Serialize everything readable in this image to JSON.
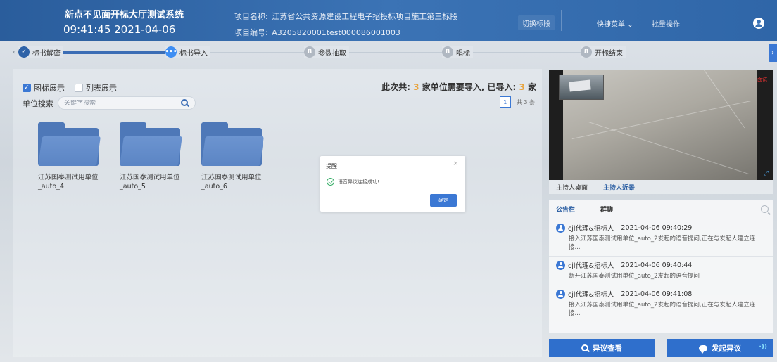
{
  "header": {
    "system_title": "新点不见面开标大厅测试系统",
    "clock": "09:41:45 2021-04-06",
    "project_name_label": "项目名称:",
    "project_name": "江苏省公共资源建设工程电子招投标项目施工第三标段",
    "project_code_label": "项目编号:",
    "project_code": "A3205820001test000086001003",
    "switch_section": "切换标段",
    "quick_menu": "快捷菜单",
    "batch_ops": "批量操作"
  },
  "steps": [
    {
      "label": "标书解密",
      "state": "done"
    },
    {
      "label": "标书导入",
      "state": "active"
    },
    {
      "label": "参数抽取",
      "state": "todo"
    },
    {
      "label": "唱标",
      "state": "todo"
    },
    {
      "label": "开标结束",
      "state": "todo"
    }
  ],
  "main": {
    "view_icon": "图标展示",
    "view_list": "列表展示",
    "search_label": "单位搜索",
    "search_placeholder": "关键字搜索",
    "stat_prefix": "此次共:",
    "stat_total": "3",
    "stat_mid": "家单位需要导入, 已导入:",
    "stat_done": "3",
    "stat_suffix": "家",
    "page": "1",
    "page_total": "共 3 条",
    "folders": [
      {
        "name": "江苏国泰测试用单位_auto_4"
      },
      {
        "name": "江苏国泰测试用单位_auto_5"
      },
      {
        "name": "江苏国泰测试用单位_auto_6"
      }
    ]
  },
  "dialog": {
    "title": "提醒",
    "close": "×",
    "message": "语音异议连接成功!",
    "ok": "确定"
  },
  "video": {
    "live_label": "面试",
    "tab_desktop": "主持人桌面",
    "tab_closeup": "主持人近景"
  },
  "notice": {
    "tab_board": "公告栏",
    "tab_chat": "群聊",
    "messages": [
      {
        "sender": "cjl代理&招标人",
        "time": "2021-04-06 09:40:29",
        "body": "接入江苏国泰测试用单位_auto_2发起的语音提问,正在与发起人建立连接..."
      },
      {
        "sender": "cjl代理&招标人",
        "time": "2021-04-06 09:40:44",
        "body": "断开江苏国泰测试用单位_auto_2发起的语音提问"
      },
      {
        "sender": "cjl代理&招标人",
        "time": "2021-04-06 09:41:08",
        "body": "接入江苏国泰测试用单位_auto_2发起的语音提问,正在与发起人建立连接..."
      }
    ]
  },
  "actions": {
    "view_objection": "异议查看",
    "raise_objection": "发起异议"
  },
  "colors": {
    "header_blue": "#3b73b5",
    "accent_blue": "#3b78d4",
    "highlight_orange": "#e8a33c",
    "success_green": "#3ab06a"
  }
}
